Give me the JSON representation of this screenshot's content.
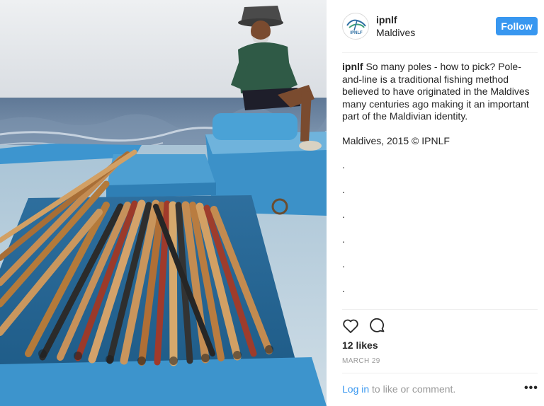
{
  "post": {
    "username": "ipnlf",
    "location": "Maldives",
    "follow_label": "Follow",
    "avatar_text": "IPNLF",
    "caption_username": "ipnlf",
    "caption_text": "So many poles - how to pick? Pole-and-line is a traditional fishing method believed to have originated in the Maldives many centuries ago making it an important part of the Maldivian identity.",
    "credit": "Maldives, 2015 © IPNLF",
    "dots": [
      ".",
      ".",
      ".",
      ".",
      ".",
      "."
    ],
    "likes": "12 likes",
    "date": "MARCH 29",
    "login_link": "Log in",
    "login_rest": " to like or comment.",
    "more_label": "•••"
  },
  "icons": {
    "like": "heart-outline-icon",
    "comment": "speech-bubble-icon",
    "more": "ellipsis-icon"
  },
  "colors": {
    "follow_button": "#3897f0",
    "link": "#3897f0",
    "text": "#262626",
    "muted": "#999999",
    "boat_blue": "#3a8fc7",
    "sea": "#5d7a99"
  }
}
